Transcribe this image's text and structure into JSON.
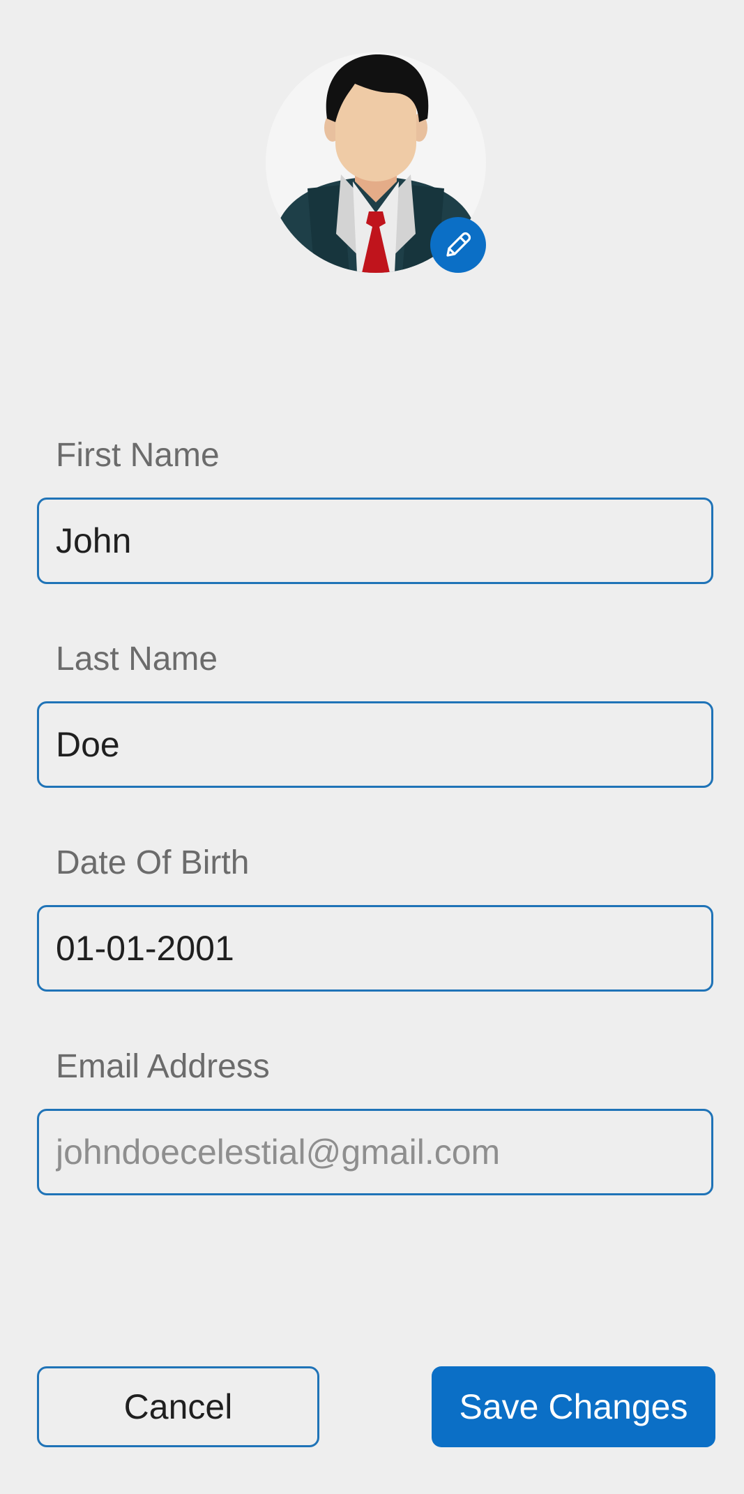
{
  "profile": {
    "avatar_icon": "user-avatar-businessman",
    "edit_icon": "pencil-icon"
  },
  "form": {
    "first_name": {
      "label": "First Name",
      "value": "John"
    },
    "last_name": {
      "label": "Last Name",
      "value": "Doe"
    },
    "dob": {
      "label": "Date Of Birth",
      "value": "01-01-2001"
    },
    "email": {
      "label": "Email Address",
      "placeholder": "johndoecelestial@gmail.com"
    }
  },
  "actions": {
    "cancel_label": "Cancel",
    "save_label": "Save Changes"
  },
  "colors": {
    "accent": "#0b6fc6",
    "border": "#1f73b7",
    "background": "#eeeeee"
  }
}
